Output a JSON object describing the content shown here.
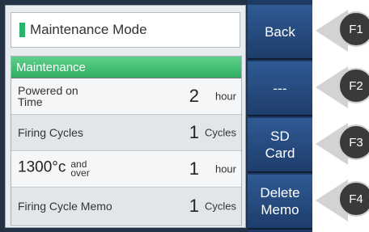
{
  "title": {
    "text": "Maintenance Mode",
    "indicator_color": "#2cb36a"
  },
  "list": {
    "header": "Maintenance",
    "rows": [
      {
        "label": "Powered on\nTime",
        "value": "2",
        "unit": "hour"
      },
      {
        "label": "Firing Cycles",
        "value": "1",
        "unit": "Cycles"
      },
      {
        "label_big": "1300°c",
        "label_small": "and\nover",
        "value": "1",
        "unit": "hour"
      },
      {
        "label": "Firing Cycle Memo",
        "value": "1",
        "unit": "Cycles"
      }
    ]
  },
  "buttons": [
    {
      "label": "Back"
    },
    {
      "label": "---"
    },
    {
      "label": "SD\nCard"
    },
    {
      "label": "Delete\nMemo"
    }
  ],
  "fkeys": [
    "F1",
    "F2",
    "F3",
    "F4"
  ]
}
